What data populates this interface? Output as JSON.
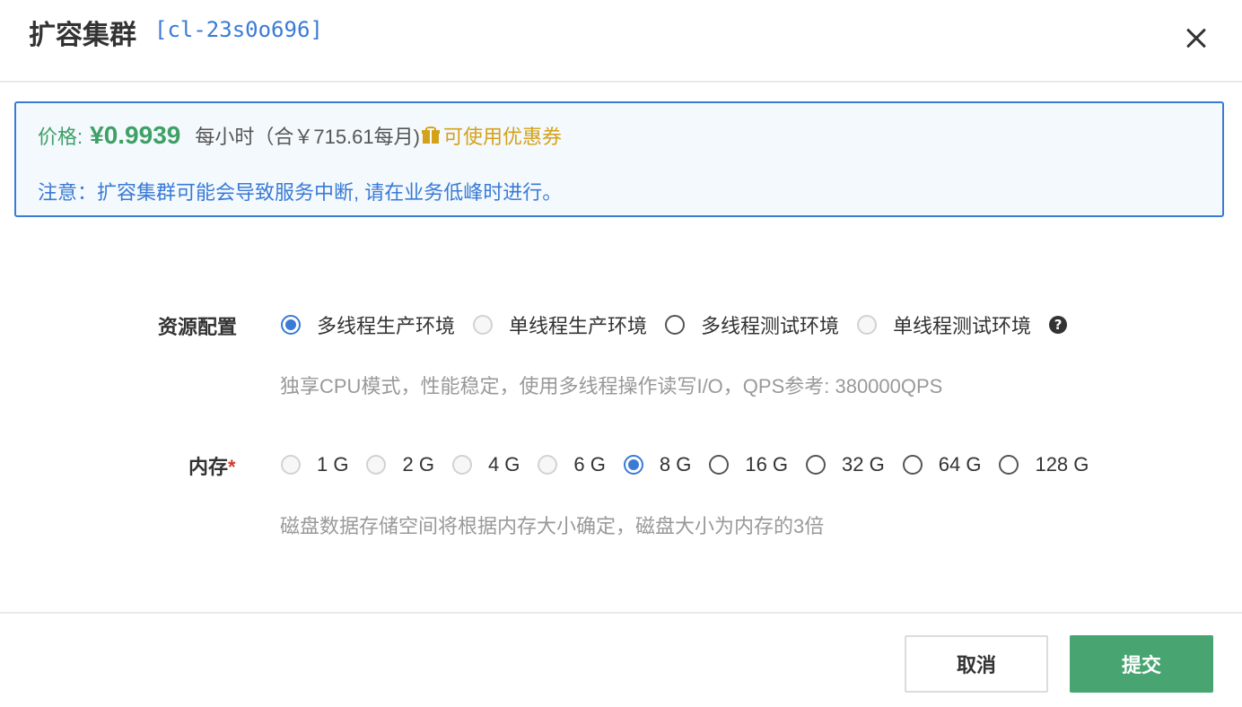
{
  "dialog": {
    "title": "扩容集群",
    "cluster_id": "[cl-23s0o696]"
  },
  "notice": {
    "price_label": "价格:",
    "price_value": "¥0.9939",
    "price_unit": "每小时（合￥715.61每月)",
    "coupon_label": "可使用优惠券",
    "warning": "注意：扩容集群可能会导致服务中断, 请在业务低峰时进行。"
  },
  "resource": {
    "label": "资源配置",
    "options": [
      {
        "label": "多线程生产环境",
        "state": "checked"
      },
      {
        "label": "单线程生产环境",
        "state": "disabled"
      },
      {
        "label": "多线程测试环境",
        "state": "enabled"
      },
      {
        "label": "单线程测试环境",
        "state": "disabled"
      }
    ],
    "hint": "独享CPU模式，性能稳定，使用多线程操作读写I/O，QPS参考: 380000QPS"
  },
  "memory": {
    "label": "内存",
    "required_mark": "*",
    "options": [
      {
        "label": "1 G",
        "state": "disabled"
      },
      {
        "label": "2 G",
        "state": "disabled"
      },
      {
        "label": "4 G",
        "state": "disabled"
      },
      {
        "label": "6 G",
        "state": "disabled"
      },
      {
        "label": "8 G",
        "state": "checked"
      },
      {
        "label": "16 G",
        "state": "enabled"
      },
      {
        "label": "32 G",
        "state": "enabled"
      },
      {
        "label": "64 G",
        "state": "enabled"
      },
      {
        "label": "128 G",
        "state": "enabled"
      }
    ],
    "hint": "磁盘数据存储空间将根据内存大小确定，磁盘大小为内存的3倍"
  },
  "footer": {
    "cancel_label": "取消",
    "submit_label": "提交"
  },
  "colors": {
    "accent_blue": "#3a7bd5",
    "price_green": "#3ea066",
    "coupon_gold": "#d4a21a",
    "submit_green": "#48a572",
    "required_red": "#d0392b"
  },
  "icons": {
    "close": "close-icon",
    "coupon": "gift-icon",
    "help": "question-circle-icon"
  }
}
